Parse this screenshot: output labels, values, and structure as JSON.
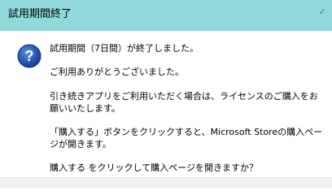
{
  "window": {
    "title": "試用期間終了",
    "close_glyph": "✓",
    "title_bar_color": "#8fd9da"
  },
  "icon": {
    "name": "question-icon",
    "color": "#1f4e9a"
  },
  "message": {
    "line1": "試用期間（7日間）が終了しました。",
    "line2": "ご利用ありがとうございました。",
    "line3": "引き続きアプリをご利用いただく場合は、ライセンスのご購入をお願いいたします。",
    "line4": "「購入する」ボタンをクリックすると、Microsoft Storeの購入ページが開きます。",
    "line5": "購入する をクリックして購入ページを開きますか？"
  }
}
